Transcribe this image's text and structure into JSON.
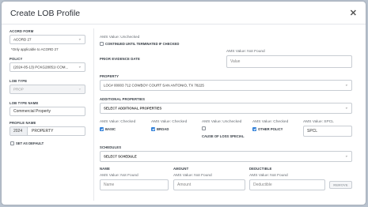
{
  "modal": {
    "title": "Create LOB Profile"
  },
  "left": {
    "acord_form": {
      "label": "ACORD FORM",
      "value": "ACORD 27",
      "note": "*Only applicable to ACORD 27"
    },
    "policy": {
      "label": "POLICY",
      "value": "(2024-05-13) PCKG28051I COM..."
    },
    "lob_type": {
      "label": "LOB TYPE",
      "value": "PROP"
    },
    "lob_type_name": {
      "label": "LOB TYPE NAME",
      "value": "Commercial Property"
    },
    "profile_name": {
      "label": "PROFILE NAME",
      "year": "2024",
      "value": "PROPERTY"
    },
    "set_as_default": {
      "label": "SET AS DEFAULT",
      "checked": false
    }
  },
  "right": {
    "continued": {
      "ams": "AMS Value: Unchecked",
      "label": "CONTINUED UNTIL TERMINATED IF CHECKED",
      "checked": false
    },
    "prior_evidence_date": {
      "label": "PRIOR EVIDENCE DATE",
      "ams": "AMS Value: Not Found",
      "placeholder": "Value"
    },
    "property": {
      "label": "PROPERTY",
      "value": "LOC# 00003 712 COWBOY COURT SAN ANTONIO, TX 78225"
    },
    "additional_properties": {
      "label": "ADDITIONAL PROPERTIES",
      "placeholder": "SELECT ADDITIONAL PROPERTIES"
    },
    "causes": [
      {
        "ams": "AMS Value: Checked",
        "label": "BASIC",
        "checked": true
      },
      {
        "ams": "AMS Value: Checked",
        "label": "BROAD",
        "checked": true
      },
      {
        "ams": "AMS Value: Unchecked",
        "label": "CAUSE OF LOSS SPECIAL",
        "checked": false
      },
      {
        "ams": "AMS Value: Checked",
        "label": "OTHER POLICY",
        "checked": true
      }
    ],
    "spcl": {
      "ams": "AMS Value: SPCL",
      "value": "SPCL"
    },
    "schedules": {
      "label": "SCHEDULES",
      "placeholder": "SELECT SCHEDULE"
    },
    "schedule_row": {
      "name": {
        "label": "NAME",
        "ams": "AMS Value: Not Found",
        "placeholder": "Name"
      },
      "amount": {
        "label": "AMOUNT",
        "ams": "AMS Value: Not Found",
        "placeholder": "Amount"
      },
      "deductible": {
        "label": "DEDUCTIBLE",
        "ams": "AMS Value: Not Found",
        "placeholder": "Deductible"
      },
      "remove_label": "REMOVE"
    }
  },
  "icons": {
    "close": "close-icon",
    "chevron": "chevron-down-icon",
    "check": "checkmark-icon"
  },
  "colors": {
    "accent": "#2f7fd9",
    "backdrop": "#b9c3cf"
  }
}
